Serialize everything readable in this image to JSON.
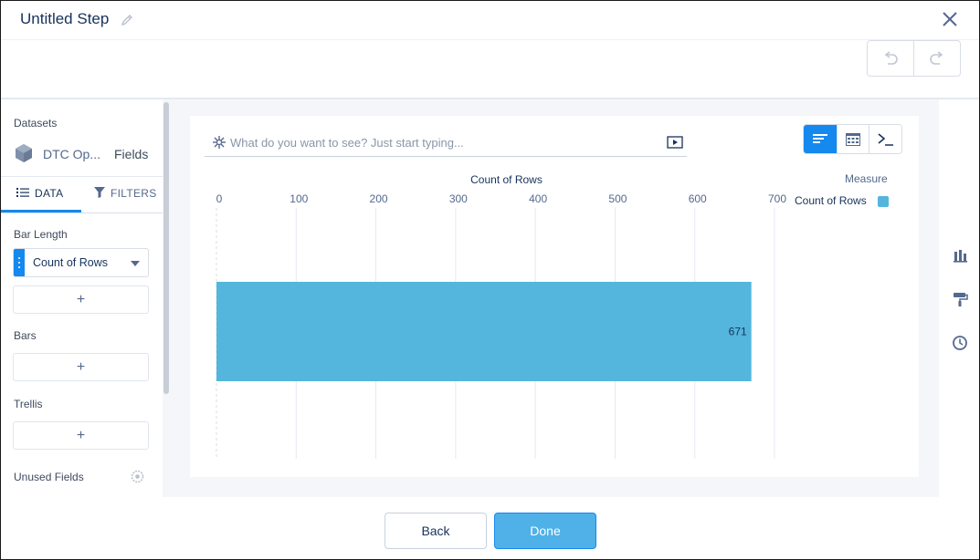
{
  "header": {
    "title": "Untitled Step",
    "icons": {
      "edit": "pencil-icon",
      "close": "close-icon",
      "undo": "undo-icon",
      "redo": "redo-icon"
    }
  },
  "left_panel": {
    "datasets_label": "Datasets",
    "dataset_name": "DTC Op...",
    "fields_link": "Fields",
    "tabs": [
      {
        "label": "DATA",
        "icon": "list-icon",
        "active": true
      },
      {
        "label": "FILTERS",
        "icon": "filter-icon",
        "active": false
      }
    ],
    "bar_length_label": "Bar Length",
    "bar_length_value": "Count of Rows",
    "add_symbol": "+",
    "bars_label": "Bars",
    "trellis_label": "Trellis",
    "unused_fields_label": "Unused Fields"
  },
  "query": {
    "placeholder": "What do you want to see? Just start typing..."
  },
  "view_buttons": [
    {
      "name": "chart-view",
      "icon": "bar-chart-icon",
      "active": true
    },
    {
      "name": "table-view",
      "icon": "table-icon",
      "active": false
    },
    {
      "name": "saql-view",
      "icon": "terminal-icon",
      "active": false
    }
  ],
  "chart_data": {
    "type": "bar",
    "orientation": "horizontal",
    "xlabel": "Count of Rows",
    "xlim": [
      0,
      700
    ],
    "ticks": [
      0,
      100,
      200,
      300,
      400,
      500,
      600,
      700
    ],
    "categories": [
      ""
    ],
    "series": [
      {
        "name": "Count of Rows",
        "values": [
          671
        ],
        "color": "#54b6dd"
      }
    ],
    "data_labels": [
      "671"
    ],
    "legend": {
      "title": "Measure",
      "placement": "top-right"
    },
    "grid": true
  },
  "right_rail": [
    "bar-chart-icon",
    "paint-roller-icon",
    "clock-icon"
  ],
  "footer": {
    "back_label": "Back",
    "done_label": "Done"
  },
  "colors": {
    "accent": "#1589ee",
    "bar": "#54b6dd",
    "done": "#4fb1e8"
  }
}
